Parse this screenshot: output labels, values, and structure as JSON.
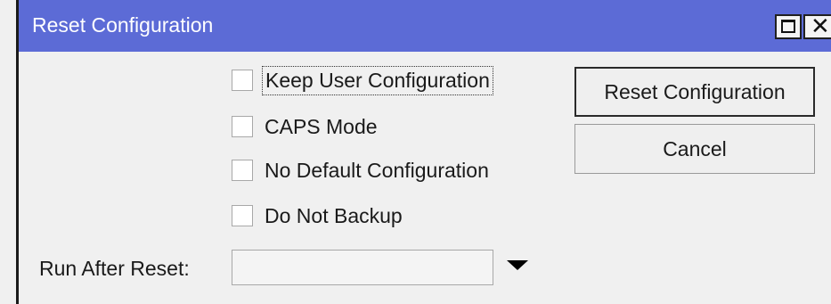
{
  "window": {
    "title": "Reset Configuration",
    "controls": [
      "maximize-icon",
      "close-icon"
    ]
  },
  "options": [
    {
      "label": "Keep User Configuration",
      "checked": false,
      "focused": true
    },
    {
      "label": "CAPS Mode",
      "checked": false,
      "focused": false
    },
    {
      "label": "No Default Configuration",
      "checked": false,
      "focused": false
    },
    {
      "label": "Do Not Backup",
      "checked": false,
      "focused": false
    }
  ],
  "buttons": {
    "reset_label": "Reset Configuration",
    "cancel_label": "Cancel"
  },
  "run_after_reset": {
    "label": "Run After Reset:",
    "value": ""
  },
  "colors": {
    "titlebar": "#5c6bd6",
    "background": "#f0f0f0"
  }
}
